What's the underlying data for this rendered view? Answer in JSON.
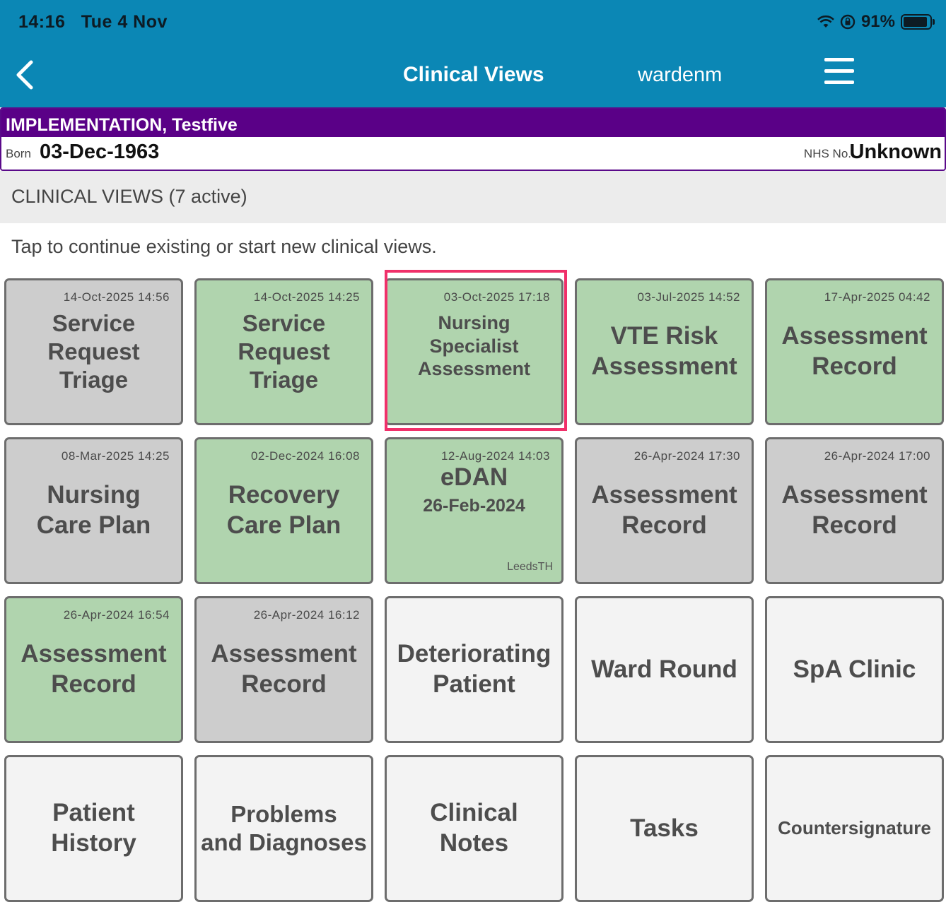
{
  "status_bar": {
    "time": "14:16",
    "date": "Tue 4 Nov",
    "battery": "91%"
  },
  "nav": {
    "title": "Clinical Views",
    "user": "wardenm"
  },
  "patient": {
    "name": "IMPLEMENTATION, Testfive",
    "born_label": "Born",
    "born": "03-Dec-1963",
    "nhs_label": "NHS No.",
    "nhs": "Unknown"
  },
  "section_header": "CLINICAL VIEWS (7 active)",
  "hint": "Tap to continue existing or start new clinical views.",
  "tiles": [
    {
      "date": "14-Oct-2025 14:56",
      "line1": "Service",
      "line2": "Request Triage",
      "state": "grey"
    },
    {
      "date": "14-Oct-2025 14:25",
      "line1": "Service",
      "line2": "Request Triage",
      "state": "green"
    },
    {
      "date": "03-Oct-2025 17:18",
      "line1": "Nursing Specialist",
      "line2": "Assessment",
      "state": "green"
    },
    {
      "date": "03-Jul-2025 14:52",
      "line1": "VTE Risk",
      "line2": "Assessment",
      "state": "green"
    },
    {
      "date": "17-Apr-2025 04:42",
      "line1": "Assessment",
      "line2": "Record",
      "state": "green"
    },
    {
      "date": "08-Mar-2025 14:25",
      "line1": "Nursing",
      "line2": "Care Plan",
      "state": "grey"
    },
    {
      "date": "02-Dec-2024 16:08",
      "line1": "Recovery",
      "line2": "Care Plan",
      "state": "green"
    },
    {
      "date": "12-Aug-2024 14:03",
      "line1": "eDAN",
      "line2": "26-Feb-2024",
      "footer": "LeedsTH",
      "state": "green"
    },
    {
      "date": "26-Apr-2024 17:30",
      "line1": "Assessment",
      "line2": "Record",
      "state": "grey"
    },
    {
      "date": "26-Apr-2024 17:00",
      "line1": "Assessment",
      "line2": "Record",
      "state": "grey"
    },
    {
      "date": "26-Apr-2024 16:54",
      "line1": "Assessment",
      "line2": "Record",
      "state": "green"
    },
    {
      "date": "26-Apr-2024 16:12",
      "line1": "Assessment",
      "line2": "Record",
      "state": "grey"
    },
    {
      "line1": "Deteriorating",
      "line2": "Patient",
      "state": "white"
    },
    {
      "line1": "Ward Round",
      "state": "white"
    },
    {
      "line1": "SpA Clinic",
      "state": "white"
    },
    {
      "line1": "Patient",
      "line2": "History",
      "state": "white"
    },
    {
      "line1": "Problems",
      "line2": "and Diagnoses",
      "state": "white"
    },
    {
      "line1": "Clinical",
      "line2": "Notes",
      "state": "white"
    },
    {
      "line1": "Tasks",
      "state": "white"
    },
    {
      "line1": "Countersignature",
      "state": "white"
    }
  ],
  "colors": {
    "header": "#0b87b5",
    "patient_banner": "#5a0087",
    "active_tile": "#b0d4ae",
    "inactive_tile": "#cdcdcd",
    "new_tile": "#f3f3f3",
    "highlight": "#f0306a"
  }
}
